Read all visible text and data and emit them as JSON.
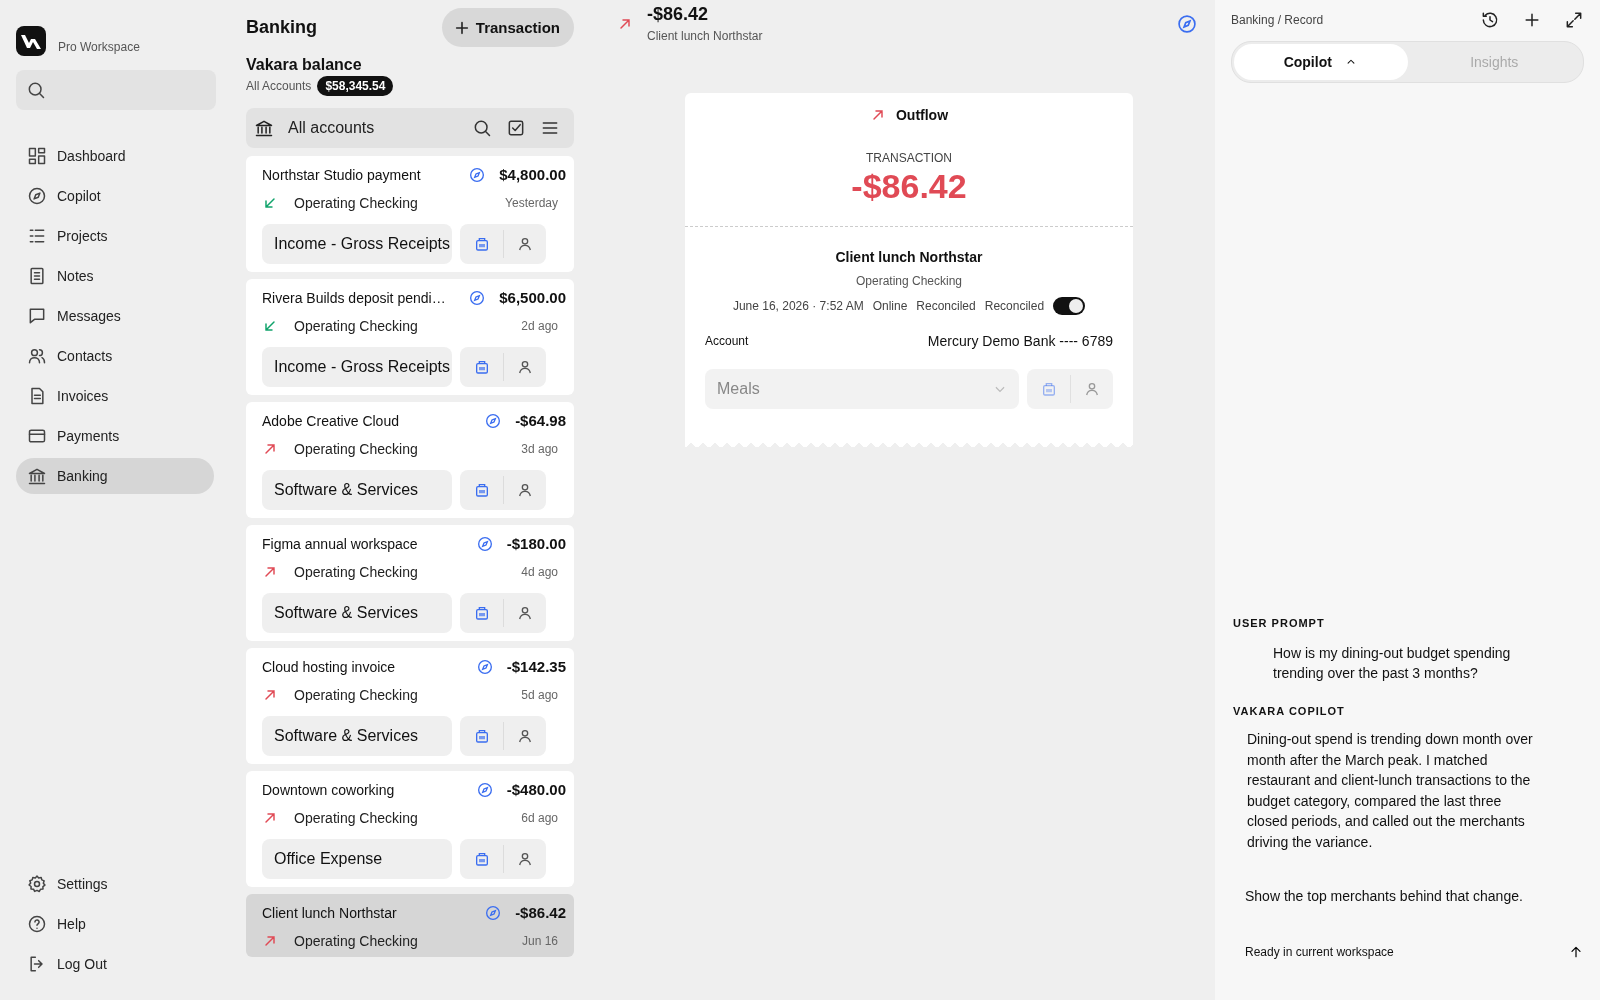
{
  "sidebar": {
    "workspace": "Pro Workspace",
    "items": [
      {
        "label": "Dashboard",
        "selected": false
      },
      {
        "label": "Copilot",
        "selected": false
      },
      {
        "label": "Projects",
        "selected": false
      },
      {
        "label": "Notes",
        "selected": false
      },
      {
        "label": "Messages",
        "selected": false
      },
      {
        "label": "Contacts",
        "selected": false
      },
      {
        "label": "Invoices",
        "selected": false
      },
      {
        "label": "Payments",
        "selected": false
      },
      {
        "label": "Banking",
        "selected": true
      }
    ],
    "footer_items": [
      {
        "label": "Settings"
      },
      {
        "label": "Help"
      },
      {
        "label": "Log Out"
      }
    ]
  },
  "list": {
    "title": "Banking",
    "new_button": "Transaction",
    "balance_title": "Vakara balance",
    "balance_scope": "All Accounts",
    "balance": "$58,345.54",
    "toolbar_label": "All accounts",
    "transactions": [
      {
        "name": "Northstar Studio payment",
        "amount": "$4,800.00",
        "kind": "inflow",
        "account": "Operating Checking",
        "date": "Yesterday",
        "category": "Income - Gross Receipts",
        "selected": false
      },
      {
        "name": "Rivera Builds deposit pendi…",
        "amount": "$6,500.00",
        "kind": "inflow",
        "account": "Operating Checking",
        "date": "2d ago",
        "category": "Income - Gross Receipts",
        "selected": false
      },
      {
        "name": "Adobe Creative Cloud",
        "amount": "-$64.98",
        "kind": "outflow",
        "account": "Operating Checking",
        "date": "3d ago",
        "category": "Software & Services",
        "selected": false
      },
      {
        "name": "Figma annual workspace",
        "amount": "-$180.00",
        "kind": "outflow",
        "account": "Operating Checking",
        "date": "4d ago",
        "category": "Software & Services",
        "selected": false
      },
      {
        "name": "Cloud hosting invoice",
        "amount": "-$142.35",
        "kind": "outflow",
        "account": "Operating Checking",
        "date": "5d ago",
        "category": "Software & Services",
        "selected": false
      },
      {
        "name": "Downtown coworking",
        "amount": "-$480.00",
        "kind": "outflow",
        "account": "Operating Checking",
        "date": "6d ago",
        "category": "Office Expense",
        "selected": false
      },
      {
        "name": "Client lunch Northstar",
        "amount": "-$86.42",
        "kind": "outflow",
        "account": "Operating Checking",
        "date": "Jun 16",
        "selected": true
      }
    ]
  },
  "detail": {
    "amount": "-$86.42",
    "subtitle": "Client lunch Northstar",
    "kind": "outflow",
    "flow_label": "Outflow",
    "type_label": "TRANSACTION",
    "big_amount": "-$86.42",
    "name": "Client lunch Northstar",
    "account": "Operating Checking",
    "meta": [
      "June 16, 2026 · 7:52 AM",
      "Online",
      "Reconciled"
    ],
    "toggle": {
      "label": "Reconciled",
      "on": true
    },
    "account_label": "Account",
    "account_value": "Mercury Demo Bank ---- 6789",
    "category": {
      "placeholder": "Meals"
    }
  },
  "copilot": {
    "breadcrumb": "Banking / Record",
    "tabs": [
      {
        "label": "Copilot",
        "selected": true
      },
      {
        "label": "Insights",
        "selected": false
      }
    ],
    "prompt_label": "USER PROMPT",
    "prompt": "How is my dining-out budget spending trending over the past 3 months?",
    "answer_label": "VAKARA COPILOT",
    "answer": "Dining-out spend is trending down month over month after the March peak. I matched restaurant and client-lunch transactions to the budget category, compared the last three closed periods, and called out the merchants driving the variance.",
    "composer": {
      "value": "Show the top merchants behind that change."
    },
    "status": "Ready in current workspace"
  }
}
